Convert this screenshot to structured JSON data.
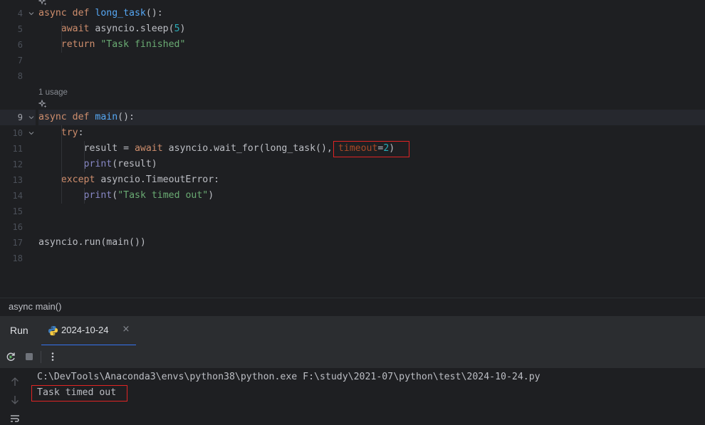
{
  "editor": {
    "lines": [
      {
        "n": "4",
        "tokens": [
          [
            "kw",
            "async "
          ],
          [
            "kw",
            "def "
          ],
          [
            "fn",
            "long_task"
          ],
          [
            "plain",
            "():"
          ]
        ]
      },
      {
        "n": "5",
        "tokens": [
          [
            "plain",
            "    "
          ],
          [
            "kw",
            "await "
          ],
          [
            "plain",
            "asyncio.sleep("
          ],
          [
            "num",
            "5"
          ],
          [
            "plain",
            ")"
          ]
        ]
      },
      {
        "n": "6",
        "tokens": [
          [
            "plain",
            "    "
          ],
          [
            "kw",
            "return "
          ],
          [
            "str",
            "\"Task finished\""
          ]
        ]
      },
      {
        "n": "7",
        "tokens": []
      },
      {
        "n": "8",
        "tokens": []
      },
      {
        "n": "9",
        "tokens": [
          [
            "kw",
            "async "
          ],
          [
            "kw",
            "def "
          ],
          [
            "fn",
            "main"
          ],
          [
            "plain",
            "():"
          ]
        ]
      },
      {
        "n": "10",
        "tokens": [
          [
            "plain",
            "    "
          ],
          [
            "kw",
            "try"
          ],
          [
            "plain",
            ":"
          ]
        ]
      },
      {
        "n": "11",
        "tokens": [
          [
            "plain",
            "        result = "
          ],
          [
            "kw",
            "await "
          ],
          [
            "plain",
            "asyncio.wait_for(long_task(), "
          ],
          [
            "param",
            "timeout"
          ],
          [
            "plain",
            "="
          ],
          [
            "num",
            "2"
          ],
          [
            "plain",
            ")"
          ]
        ]
      },
      {
        "n": "12",
        "tokens": [
          [
            "plain",
            "        "
          ],
          [
            "builtin",
            "print"
          ],
          [
            "plain",
            "(result)"
          ]
        ]
      },
      {
        "n": "13",
        "tokens": [
          [
            "plain",
            "    "
          ],
          [
            "kw",
            "except "
          ],
          [
            "plain",
            "asyncio.TimeoutError:"
          ]
        ]
      },
      {
        "n": "14",
        "tokens": [
          [
            "plain",
            "        "
          ],
          [
            "builtin",
            "print"
          ],
          [
            "plain",
            "("
          ],
          [
            "str",
            "\"Task timed out\""
          ],
          [
            "plain",
            ")"
          ]
        ]
      },
      {
        "n": "15",
        "tokens": []
      },
      {
        "n": "16",
        "tokens": []
      },
      {
        "n": "17",
        "tokens": [
          [
            "plain",
            "asyncio.run(main())"
          ]
        ]
      },
      {
        "n": "18",
        "tokens": []
      }
    ],
    "usage_hint": "1 usage",
    "current_line": "9"
  },
  "breadcrumb": "async main()",
  "run_panel": {
    "title": "Run",
    "tab_label": "2024-10-24",
    "tab_close": "×",
    "console_lines": [
      "C:\\DevTools\\Anaconda3\\envs\\python38\\python.exe F:\\study\\2021-07\\python\\test\\2024-10-24.py",
      "Task timed out"
    ]
  },
  "colors": {
    "keyword": "#cf8e6d",
    "function": "#56a8f5",
    "number": "#2aacb8",
    "string": "#6aab73",
    "builtin": "#8888c6",
    "param": "#aa4926",
    "highlight_box": "#e02424",
    "accent": "#3574f0"
  },
  "icons": {
    "ai_assistant": "ai-sparkle-icon",
    "fold": "chevron-down-icon",
    "python_file": "python-icon",
    "rerun": "rerun-icon",
    "stop": "stop-icon",
    "more": "more-vertical-icon",
    "scroll_up": "arrow-up-icon",
    "scroll_down": "arrow-down-icon",
    "soft_wrap": "soft-wrap-icon"
  }
}
